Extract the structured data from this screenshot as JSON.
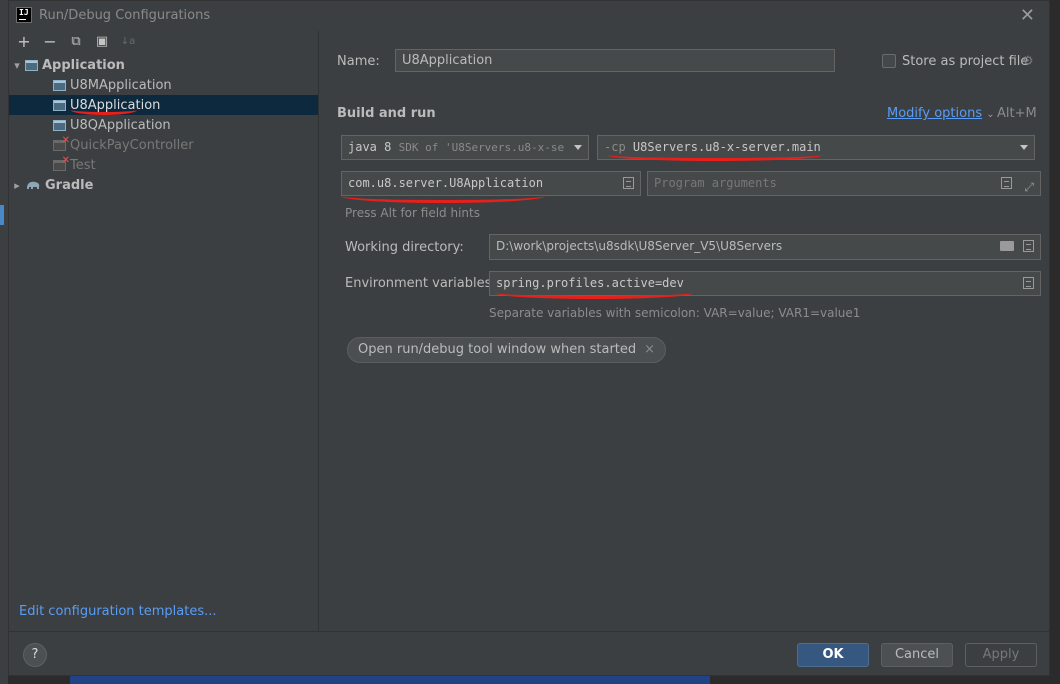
{
  "window": {
    "app_icon_text": "IJ",
    "title": "Run/Debug Configurations"
  },
  "toolbar": {
    "add": "+",
    "remove": "−",
    "copy": "⧉",
    "folder": "▣",
    "sort": "↓a"
  },
  "tree": {
    "application_group": "Application",
    "items": [
      {
        "label": "U8MApplication"
      },
      {
        "label": "U8Application"
      },
      {
        "label": "U8QApplication"
      },
      {
        "label": "QuickPayController"
      },
      {
        "label": "Test"
      }
    ],
    "gradle_group": "Gradle",
    "edit_templates_link": "Edit configuration templates..."
  },
  "form": {
    "name_label": "Name:",
    "name_value": "U8Application",
    "store_label": "Store as project file",
    "build_run_title": "Build and run",
    "modify_options": "Modify options",
    "modify_shortcut": "Alt+M",
    "jdk_prefix": "java 8",
    "jdk_suffix": "SDK of 'U8Servers.u8-x-se",
    "cp_prefix": "-cp",
    "cp_value": "U8Servers.u8-x-server.main",
    "main_class": "com.u8.server.U8Application",
    "program_args_placeholder": "Program arguments",
    "field_hints": "Press Alt for field hints",
    "working_dir_label": "Working directory:",
    "working_dir_value": "D:\\work\\projects\\u8sdk\\U8Server_V5\\U8Servers",
    "env_label": "Environment variables:",
    "env_value": "spring.profiles.active=dev",
    "env_hint": "Separate variables with semicolon: VAR=value; VAR1=value1",
    "chip_label": "Open run/debug tool window when started",
    "chip_close": "×"
  },
  "buttons": {
    "help": "?",
    "ok": "OK",
    "cancel": "Cancel",
    "apply": "Apply"
  },
  "colors": {
    "accent": "#589df6",
    "selection": "#0d293e",
    "primary_button": "#365880",
    "annotation_red": "#e8201c"
  }
}
